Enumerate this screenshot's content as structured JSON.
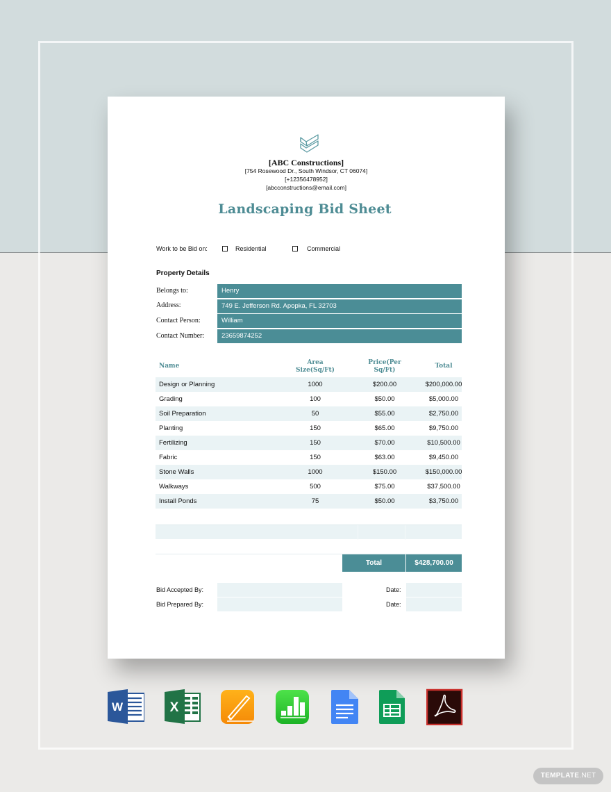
{
  "company": {
    "name": "[ABC Constructions]",
    "address": "[754 Rosewood Dr., South Windsor, CT 06074]",
    "phone": "[+12356478952]",
    "email": "[abcconstructions@email.com]",
    "logo_icon": "chevron-stack-logo-icon"
  },
  "document": {
    "title": "Landscaping Bid Sheet",
    "work_to_bid_label": "Work to be Bid on:",
    "options": [
      {
        "label": "Residential",
        "checked": false
      },
      {
        "label": "Commercial",
        "checked": false
      }
    ],
    "property_section_title": "Property Details",
    "property": [
      {
        "label": "Belongs to:",
        "value": "Henry"
      },
      {
        "label": "Address:",
        "value": "749 E. Jefferson Rd. Apopka, FL 32703"
      },
      {
        "label": "Contact Person:",
        "value": "William"
      },
      {
        "label": "Contact Number:",
        "value": "23659874252"
      }
    ],
    "table": {
      "headers": {
        "name": "Name",
        "area_line1": "Area",
        "area_line2": "Size(Sq/Ft)",
        "price_line1": "Price(Per",
        "price_line2": "Sq/Ft)",
        "total": "Total"
      },
      "rows": [
        {
          "name": "Design or Planning",
          "area": "1000",
          "price": "$200.00",
          "total": "$200,000.00"
        },
        {
          "name": "Grading",
          "area": "100",
          "price": "$50.00",
          "total": "$5,000.00"
        },
        {
          "name": "Soil Preparation",
          "area": "50",
          "price": "$55.00",
          "total": "$2,750.00"
        },
        {
          "name": "Planting",
          "area": "150",
          "price": "$65.00",
          "total": "$9,750.00"
        },
        {
          "name": "Fertilizing",
          "area": "150",
          "price": "$70.00",
          "total": "$10,500.00"
        },
        {
          "name": "Fabric",
          "area": "150",
          "price": "$63.00",
          "total": "$9,450.00"
        },
        {
          "name": "Stone Walls",
          "area": "1000",
          "price": "$150.00",
          "total": "$150,000.00"
        },
        {
          "name": "Walkways",
          "area": "500",
          "price": "$75.00",
          "total": "$37,500.00"
        },
        {
          "name": "Install Ponds",
          "area": "75",
          "price": "$50.00",
          "total": "$3,750.00"
        }
      ],
      "total_label": "Total",
      "total_value": "$428,700.00"
    },
    "signatures": [
      {
        "label": "Bid Accepted By:",
        "value": "",
        "date_label": "Date:",
        "date_value": ""
      },
      {
        "label": "Bid Prepared By:",
        "value": "",
        "date_label": "Date:",
        "date_value": ""
      }
    ]
  },
  "formats": [
    {
      "name": "Microsoft Word",
      "icon": "word-icon"
    },
    {
      "name": "Microsoft Excel",
      "icon": "excel-icon"
    },
    {
      "name": "Apple Pages",
      "icon": "pages-icon"
    },
    {
      "name": "Apple Numbers",
      "icon": "numbers-icon"
    },
    {
      "name": "Google Docs",
      "icon": "google-docs-icon"
    },
    {
      "name": "Google Sheets",
      "icon": "google-sheets-icon"
    },
    {
      "name": "Adobe PDF",
      "icon": "adobe-pdf-icon"
    }
  ],
  "brand": {
    "bold": "TEMPLATE",
    "rest": ".NET"
  },
  "colors": {
    "accent": "#4b8d96",
    "title": "#4e8c94",
    "row_alt": "#eaf3f5",
    "bg_top": "#d2dcdd",
    "bg_bottom": "#ebeae8"
  }
}
